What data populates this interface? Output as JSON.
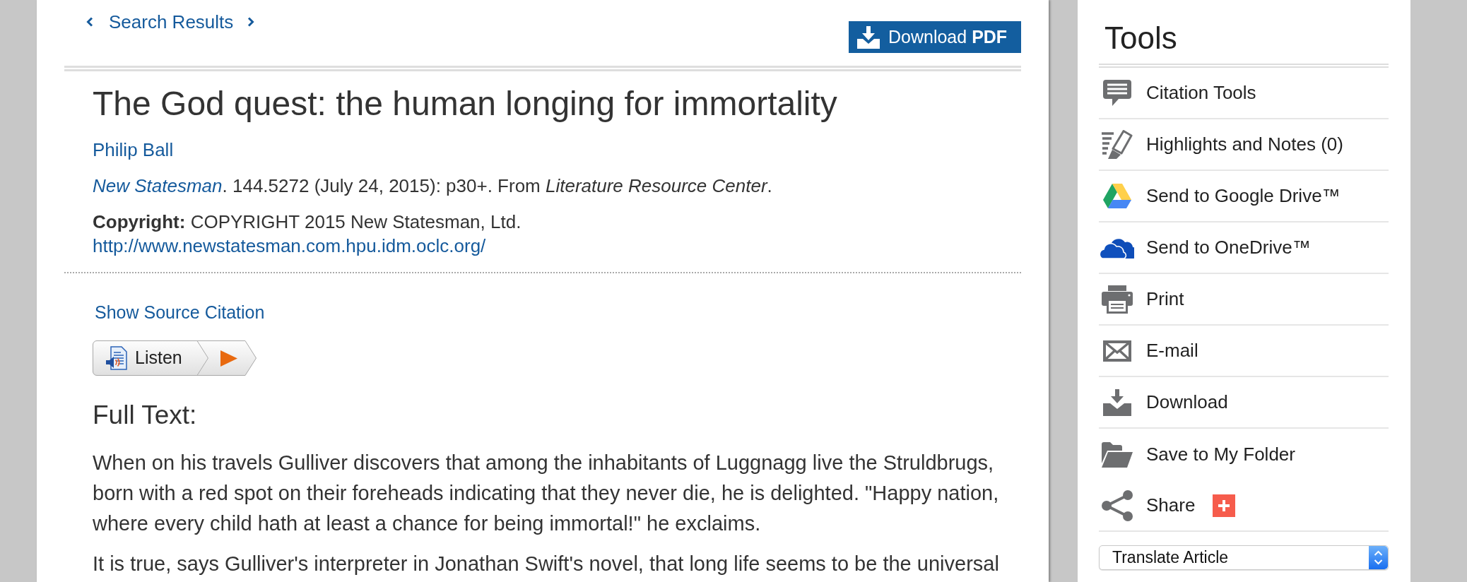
{
  "results_nav": {
    "label": "Search Results"
  },
  "download_pdf": {
    "label": "Download **PDF**"
  },
  "article": {
    "title": "The God quest: the human longing for immortality",
    "author": "Philip Ball",
    "source": {
      "journal": "New Statesman",
      "details": ". 144.5272 (July 24, 2015): p30+. From *Literature Resource Center*."
    },
    "copyright": "**Copyright:** COPYRIGHT 2015 New Statesman, Ltd.",
    "url": "http://www.newstatesman.com.hpu.idm.oclc.org/",
    "show_citation": "Show Source Citation",
    "listen": {
      "label": "Listen"
    },
    "full_text_heading": "Full Text:",
    "paragraphs": [
      "When on his travels Gulliver discovers that among the inhabitants of Luggnagg live the Struldbrugs, born with a red spot on their foreheads indicating that they never die, he is delighted. \"Happy nation, where every child hath at least a chance for being immortal!\" he exclaims.",
      "It is true, says Gulliver's interpreter in Jonathan Swift's novel, that long life seems to be the universal"
    ]
  },
  "tools": {
    "title": "Tools",
    "items": [
      {
        "kind": "citation",
        "label": "Citation Tools"
      },
      {
        "kind": "highlights",
        "label": "Highlights and Notes (0)"
      },
      {
        "kind": "google_drive",
        "label": "Send to Google Drive™"
      },
      {
        "kind": "onedrive",
        "label": "Send to OneDrive™"
      },
      {
        "kind": "print",
        "label": "Print"
      },
      {
        "kind": "email",
        "label": "E-mail"
      },
      {
        "kind": "download",
        "label": "Download"
      },
      {
        "kind": "folder",
        "label": "Save to My Folder"
      }
    ],
    "share": {
      "label": "Share"
    },
    "translate": {
      "value": "Translate Article"
    }
  }
}
